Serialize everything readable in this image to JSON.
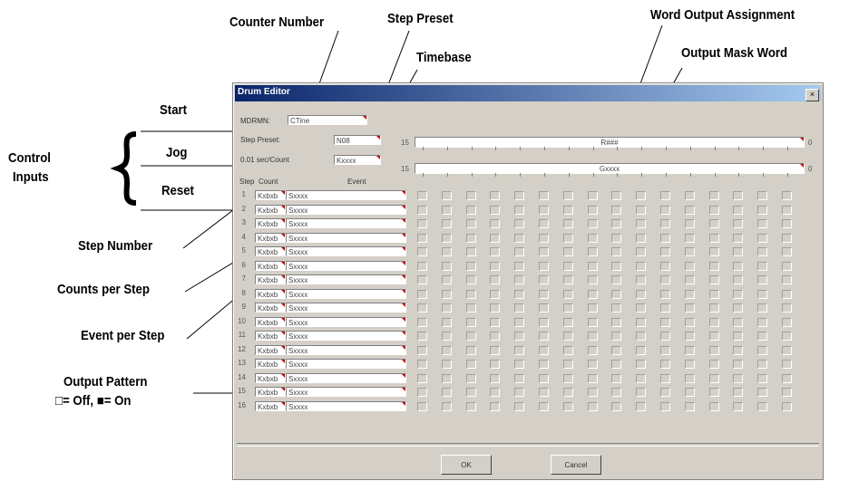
{
  "callouts": {
    "counter_number": "Counter Number",
    "step_preset": "Step Preset",
    "word_output_assignment": "Word Output Assignment",
    "timebase": "Timebase",
    "output_mask_word": "Output Mask Word",
    "start": "Start",
    "jog": "Jog",
    "reset": "Reset",
    "control_inputs_line1": "Control",
    "control_inputs_line2": "Inputs",
    "step_number": "Step Number",
    "counts_per_step": "Counts per Step",
    "event_per_step": "Event per Step",
    "output_pattern_line1": "Output Pattern",
    "output_pattern_line2": "□= Off, ■= On"
  },
  "dialog": {
    "title": "Drum Editor",
    "close_icon": "close-icon",
    "counter_label": "MDRMN:",
    "counter_value": "CTine",
    "step_preset_label": "Step Preset:",
    "step_preset_value": "N08",
    "timebase_label": "0.01 sec/Count",
    "timebase_value": "Kxxxx",
    "word_output_bit_high": "15",
    "word_output_bit_low": "0",
    "word_output_value": "R###",
    "mask_bit_high": "15",
    "mask_bit_low": "0",
    "mask_value": "Gxxxx",
    "col_step": "Step",
    "col_count": "Count",
    "col_event": "Event",
    "rows": [
      {
        "step": "1",
        "count": "Kxbxb",
        "event": "Sxxxx"
      },
      {
        "step": "2",
        "count": "Kxbxb",
        "event": "Sxxxx"
      },
      {
        "step": "3",
        "count": "Kxbxb",
        "event": "Sxxxx"
      },
      {
        "step": "4",
        "count": "Kxbxb",
        "event": "Sxxxx"
      },
      {
        "step": "5",
        "count": "Kxbxb",
        "event": "Sxxxx"
      },
      {
        "step": "6",
        "count": "Kxbxb",
        "event": "Sxxxx"
      },
      {
        "step": "7",
        "count": "Kxbxb",
        "event": "Sxxxx"
      },
      {
        "step": "8",
        "count": "Kxbxb",
        "event": "Sxxxx"
      },
      {
        "step": "9",
        "count": "Kxbxb",
        "event": "Sxxxx"
      },
      {
        "step": "10",
        "count": "Kxbxb",
        "event": "Sxxxx"
      },
      {
        "step": "11",
        "count": "Kxbxb",
        "event": "Sxxxx"
      },
      {
        "step": "12",
        "count": "Kxbxb",
        "event": "Sxxxx"
      },
      {
        "step": "13",
        "count": "Kxbxb",
        "event": "Sxxxx"
      },
      {
        "step": "14",
        "count": "Kxbxb",
        "event": "Sxxxx"
      },
      {
        "step": "15",
        "count": "Kxbxb",
        "event": "Sxxxx"
      },
      {
        "step": "16",
        "count": "Kxbxb",
        "event": "Sxxxx"
      }
    ],
    "output_columns": 16,
    "ok_label": "OK",
    "cancel_label": "Cancel"
  }
}
